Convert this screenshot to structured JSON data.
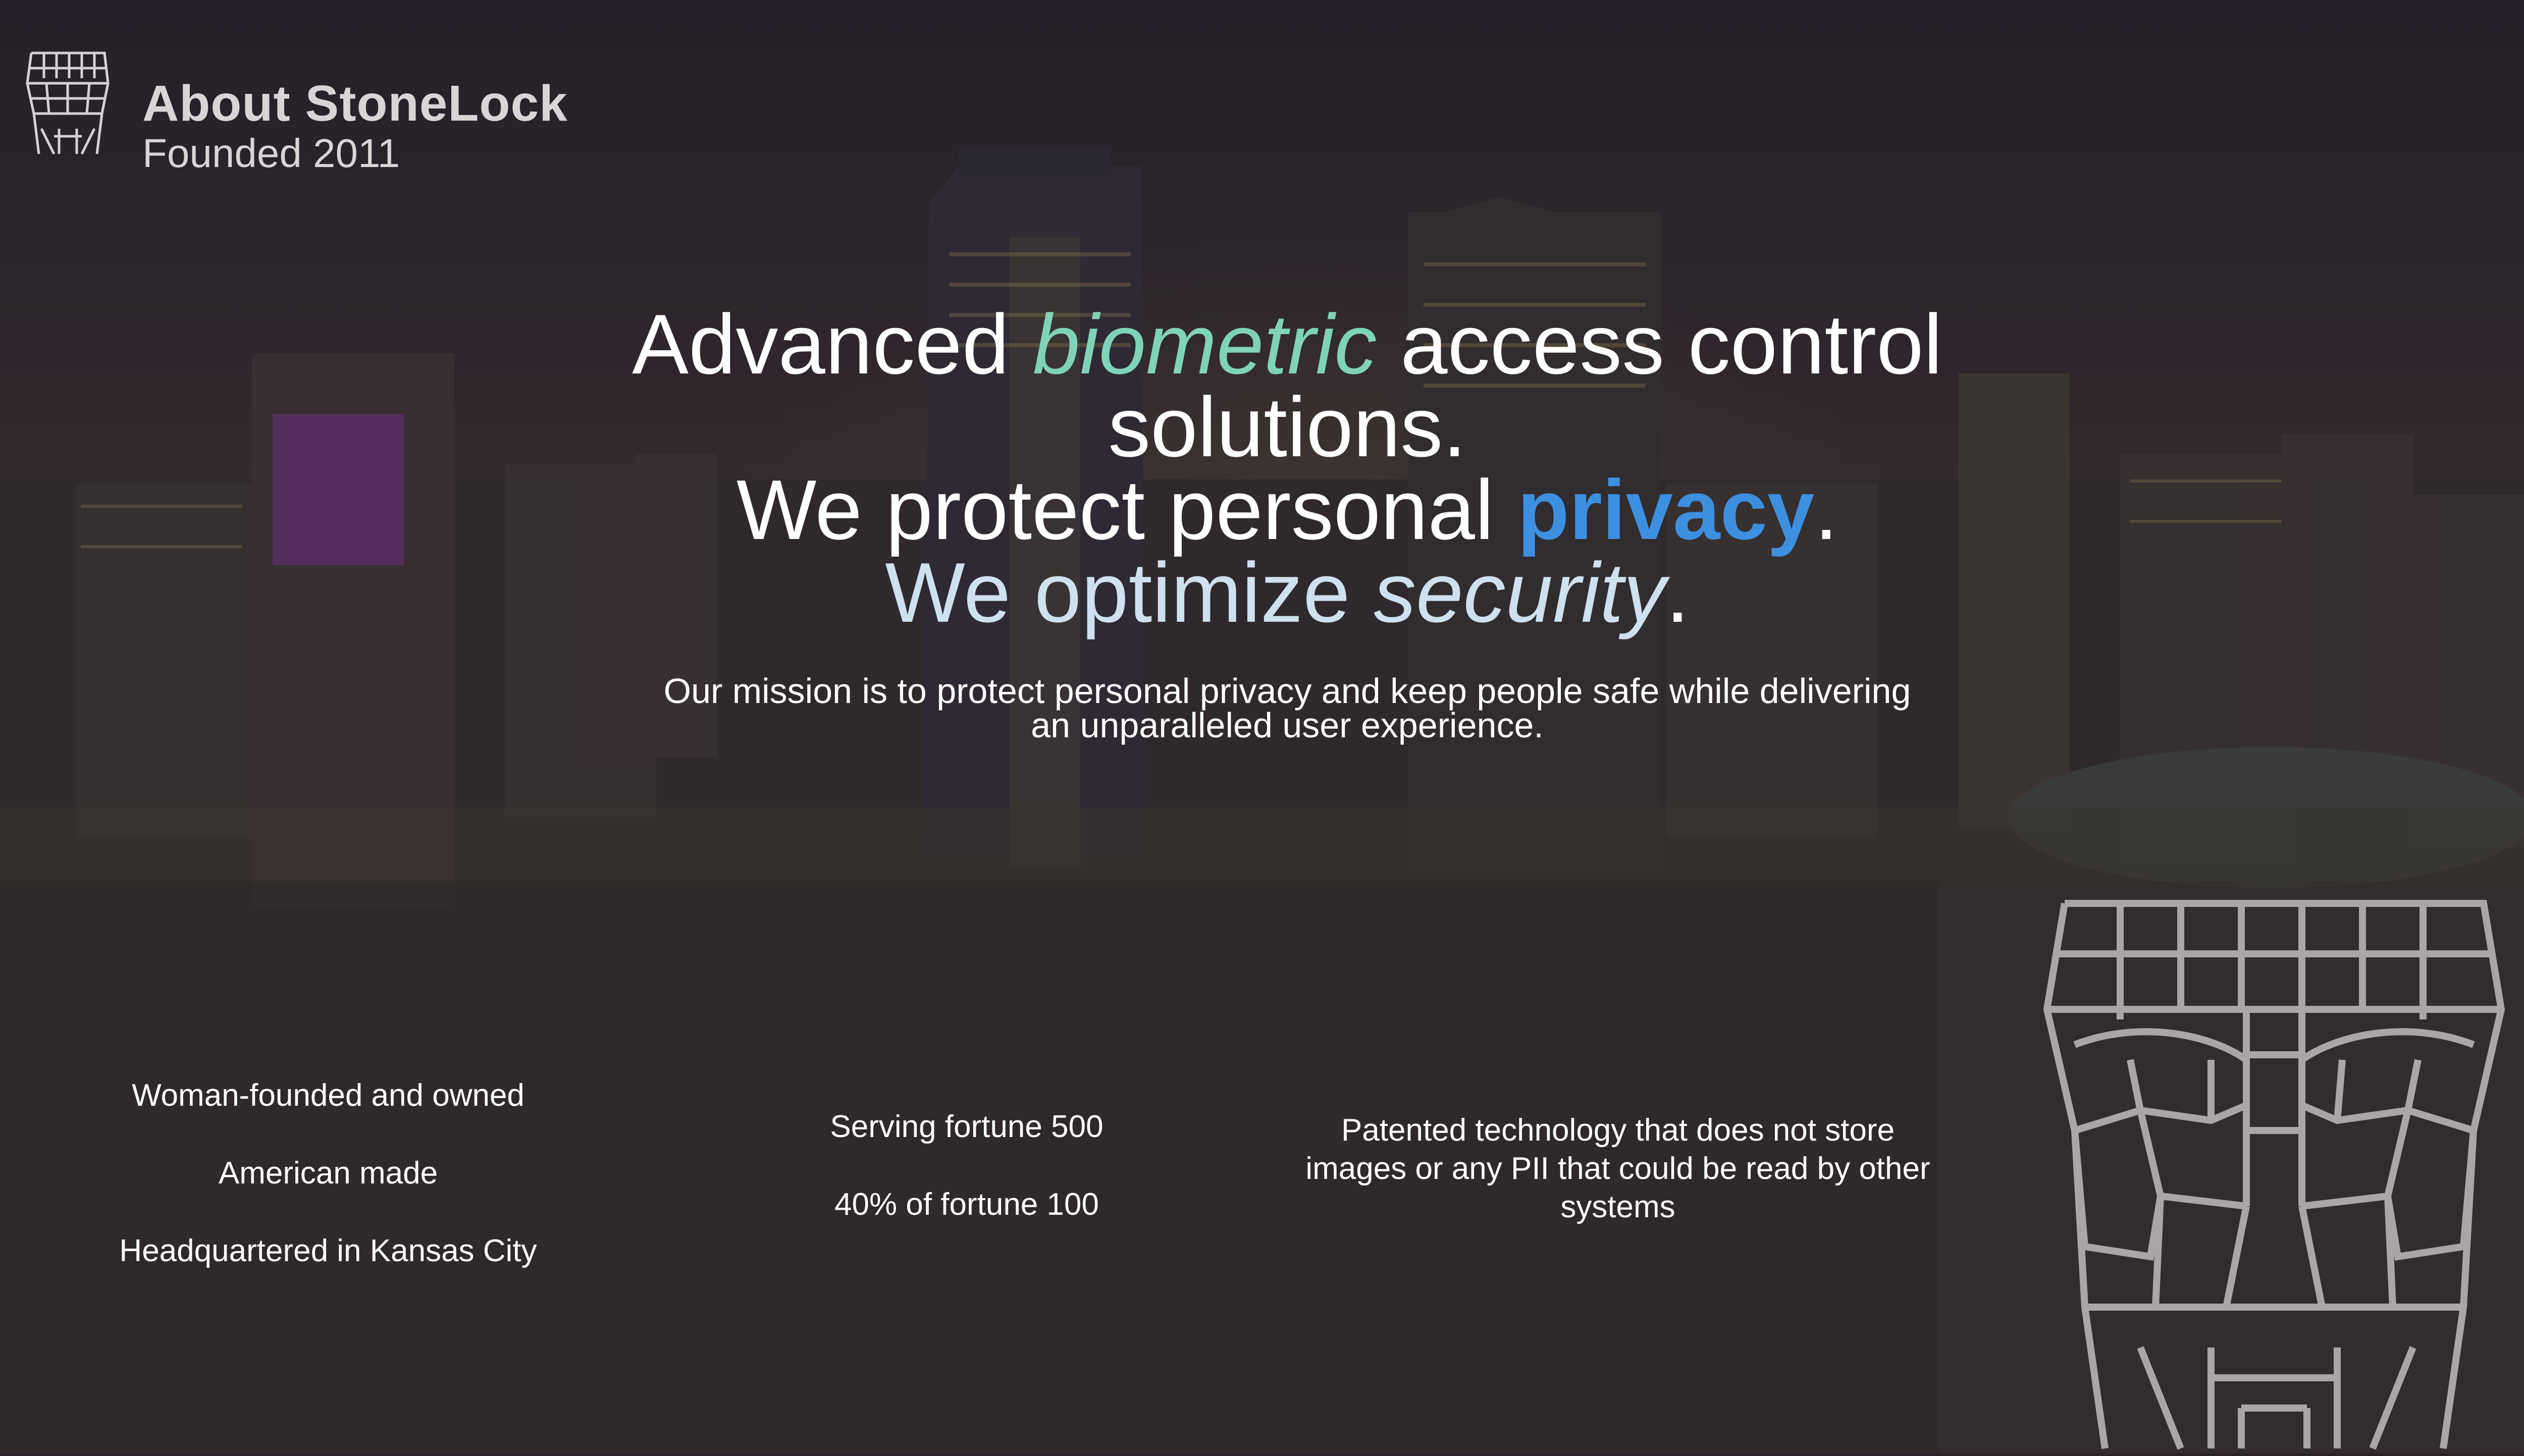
{
  "header": {
    "title": "About StoneLock",
    "subtitle": "Founded 2011",
    "logo_icon": "face-grid-icon"
  },
  "hero": {
    "line1": {
      "before": "Advanced ",
      "accent": "biometric",
      "after": " access control"
    },
    "line2": "solutions.",
    "line3": {
      "before": "We protect personal ",
      "accent": "privacy",
      "after": "."
    },
    "line4": {
      "before": "We optimize ",
      "accent": "security",
      "after": "."
    },
    "mission": "Our mission is to protect personal privacy and keep people safe while delivering an unparalleled user experience."
  },
  "features": {
    "column1": [
      "Woman-founded and owned",
      "American made",
      "Headquartered in Kansas City"
    ],
    "column2": [
      "Serving fortune 500",
      "40% of fortune 100"
    ],
    "column3": "Patented technology that does not store images or any PII that could be read by other systems"
  },
  "decor": {
    "face_icon": "face-grid-icon",
    "background": "kansas-city-skyline-photo"
  },
  "colors": {
    "biometric_accent": "#7fd3b8",
    "privacy_accent": "#3d8fe0",
    "security_line": "#cfe0ee",
    "text": "#ffffff"
  }
}
